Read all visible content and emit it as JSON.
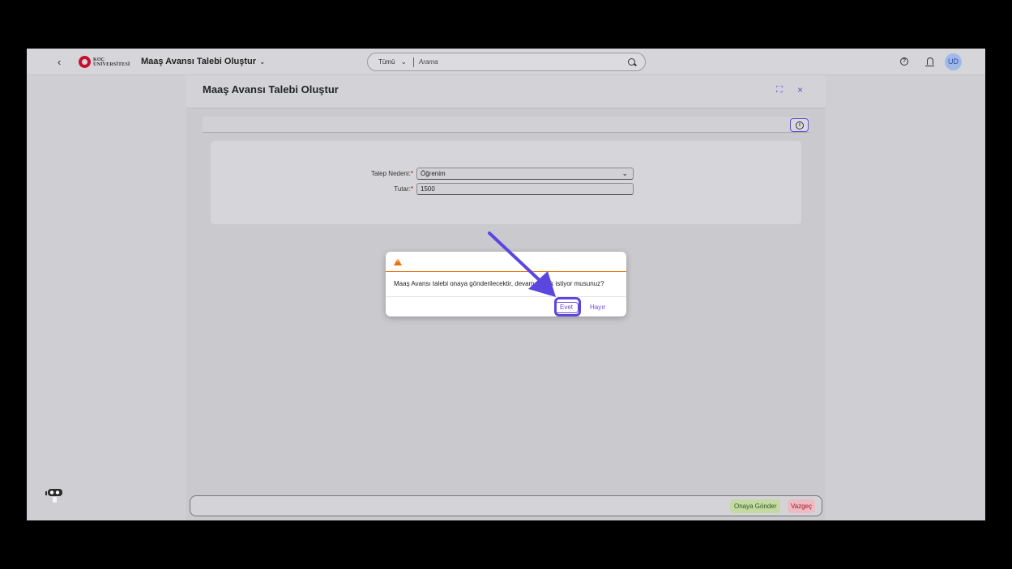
{
  "shell": {
    "back_glyph": "‹",
    "logo_line1": "KOÇ",
    "logo_line2": "ÜNİVERSİTESİ",
    "app_title": "Maaş Avansı Talebi Oluştur",
    "search_scope": "Tümü",
    "search_placeholder": "Arama",
    "help_glyph": "?",
    "avatar_initials": "UD"
  },
  "page": {
    "title": "Maaş Avansı Talebi Oluştur",
    "expand_glyph": "⛶",
    "close_glyph": "×",
    "info_glyph": "i"
  },
  "form": {
    "reason_label": "Talep Nedeni:",
    "reason_value": "Öğrenim",
    "amount_label": "Tutar:",
    "amount_value": "1500",
    "required_mark": "*"
  },
  "dialog": {
    "message": "Maaş Avansı talebi onaya gönderilecektir, devam etmek istiyor musunuz?",
    "yes_label": "Evet",
    "no_label": "Hayır"
  },
  "footer": {
    "submit_label": "Onaya Gönder",
    "cancel_label": "Vazgeç"
  },
  "colors": {
    "accent": "#6a4cd6",
    "warning": "#e9730c",
    "annotation_arrow": "#5b47e0"
  }
}
